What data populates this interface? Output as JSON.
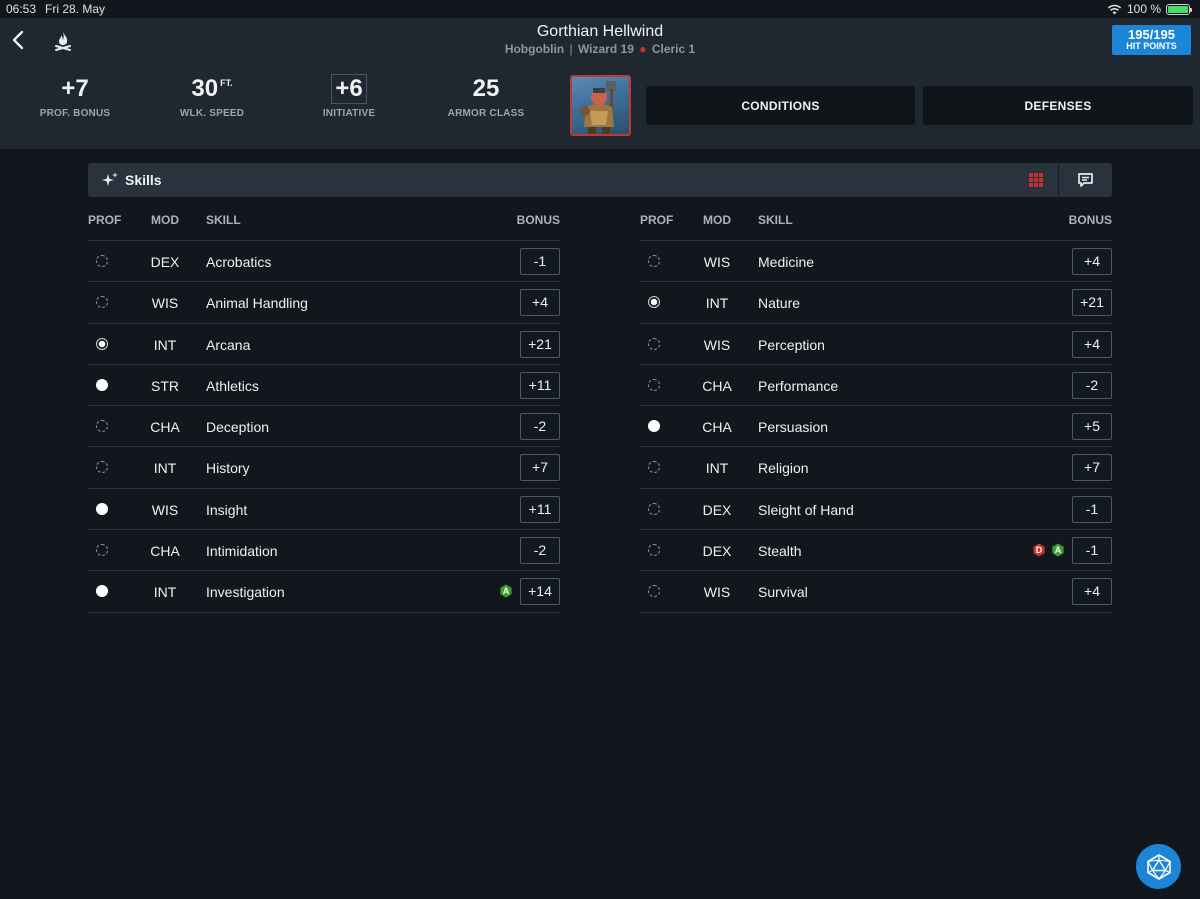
{
  "status_bar": {
    "time": "06:53",
    "date": "Fri 28. May",
    "battery": "100 %"
  },
  "header": {
    "name": "Gorthian Hellwind",
    "race": "Hobgoblin",
    "class1": "Wizard 19",
    "class2": "Cleric 1",
    "hp": {
      "value": "195/195",
      "label": "HIT POINTS"
    },
    "stats": {
      "prof": {
        "value": "+7",
        "label": "PROF. BONUS"
      },
      "speed": {
        "value": "30",
        "unit": "FT.",
        "label": "WLK. SPEED"
      },
      "initiative": {
        "value": "+6",
        "label": "INITIATIVE"
      },
      "ac": {
        "value": "25",
        "label": "ARMOR CLASS"
      }
    },
    "conditions_label": "CONDITIONS",
    "defenses_label": "DEFENSES"
  },
  "skills": {
    "title": "Skills",
    "headers": {
      "prof": "PROF",
      "mod": "MOD",
      "skill": "SKILL",
      "bonus": "BONUS"
    },
    "left": [
      {
        "prof": "none",
        "mod": "DEX",
        "skill": "Acrobatics",
        "bonus": "-1"
      },
      {
        "prof": "none",
        "mod": "WIS",
        "skill": "Animal Handling",
        "bonus": "+4"
      },
      {
        "prof": "half",
        "mod": "INT",
        "skill": "Arcana",
        "bonus": "+21"
      },
      {
        "prof": "full",
        "mod": "STR",
        "skill": "Athletics",
        "bonus": "+11"
      },
      {
        "prof": "none",
        "mod": "CHA",
        "skill": "Deception",
        "bonus": "-2"
      },
      {
        "prof": "none",
        "mod": "INT",
        "skill": "History",
        "bonus": "+7"
      },
      {
        "prof": "full",
        "mod": "WIS",
        "skill": "Insight",
        "bonus": "+11"
      },
      {
        "prof": "none",
        "mod": "CHA",
        "skill": "Intimidation",
        "bonus": "-2"
      },
      {
        "prof": "full",
        "mod": "INT",
        "skill": "Investigation",
        "bonus": "+14",
        "badges": [
          "A"
        ]
      }
    ],
    "right": [
      {
        "prof": "none",
        "mod": "WIS",
        "skill": "Medicine",
        "bonus": "+4"
      },
      {
        "prof": "half",
        "mod": "INT",
        "skill": "Nature",
        "bonus": "+21"
      },
      {
        "prof": "none",
        "mod": "WIS",
        "skill": "Perception",
        "bonus": "+4"
      },
      {
        "prof": "none",
        "mod": "CHA",
        "skill": "Performance",
        "bonus": "-2"
      },
      {
        "prof": "full",
        "mod": "CHA",
        "skill": "Persuasion",
        "bonus": "+5"
      },
      {
        "prof": "none",
        "mod": "INT",
        "skill": "Religion",
        "bonus": "+7"
      },
      {
        "prof": "none",
        "mod": "DEX",
        "skill": "Sleight of Hand",
        "bonus": "-1"
      },
      {
        "prof": "none",
        "mod": "DEX",
        "skill": "Stealth",
        "bonus": "-1",
        "badges": [
          "D",
          "A"
        ]
      },
      {
        "prof": "none",
        "mod": "WIS",
        "skill": "Survival",
        "bonus": "+4"
      }
    ]
  },
  "colors": {
    "accent": "#1b86d8",
    "danger": "#c53131",
    "advantage": "#3f9b2f",
    "header_bg": "#1f2730",
    "page_bg": "#12171d"
  },
  "icons": [
    "back-chevron-icon",
    "campfire-icon",
    "sparkle-icon",
    "grid-icon",
    "chat-bubble-icon",
    "d20-icon",
    "wifi-icon",
    "battery-icon"
  ]
}
